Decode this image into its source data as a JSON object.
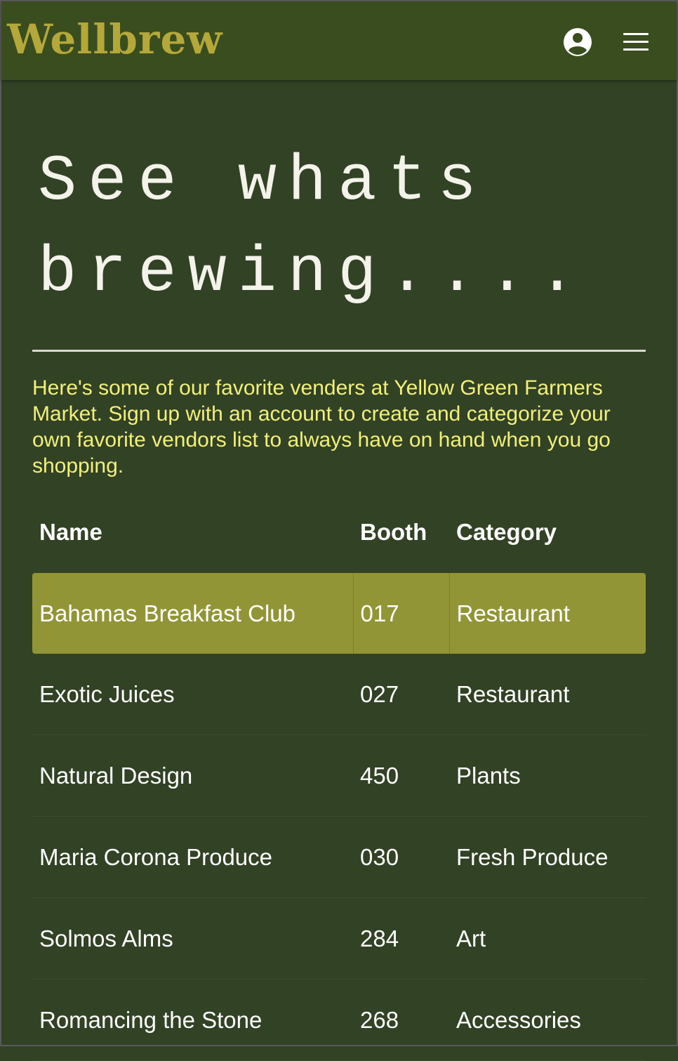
{
  "navbar": {
    "brand": "Wellbrew",
    "user_icon": "user-circle-icon",
    "menu_icon": "hamburger-menu-icon"
  },
  "hero": {
    "title_line1": "See whats",
    "title_line2": "brewing...."
  },
  "intro": {
    "text": "Here's some of our favorite venders at Yellow Green Farmers Market. Sign up with an account to create and categorize your own favorite vendors list to always have on hand when you go shopping."
  },
  "table": {
    "headers": {
      "name": "Name",
      "booth": "Booth",
      "category": "Category"
    },
    "rows": [
      {
        "name": "Bahamas Breakfast Club",
        "booth": "017",
        "category": "Restaurant"
      },
      {
        "name": "Exotic Juices",
        "booth": "027",
        "category": "Restaurant"
      },
      {
        "name": "Natural Design",
        "booth": "450",
        "category": "Plants"
      },
      {
        "name": "Maria Corona Produce",
        "booth": "030",
        "category": "Fresh Produce"
      },
      {
        "name": "Solmos Alms",
        "booth": "284",
        "category": "Art"
      },
      {
        "name": "Romancing the Stone",
        "booth": "268",
        "category": "Accessories"
      }
    ]
  },
  "colors": {
    "page_background": "#324225",
    "navbar_background": "#3a4d1f",
    "brand": "#b4a83a",
    "intro_text": "#f1f07a",
    "active_row": "#929536"
  }
}
